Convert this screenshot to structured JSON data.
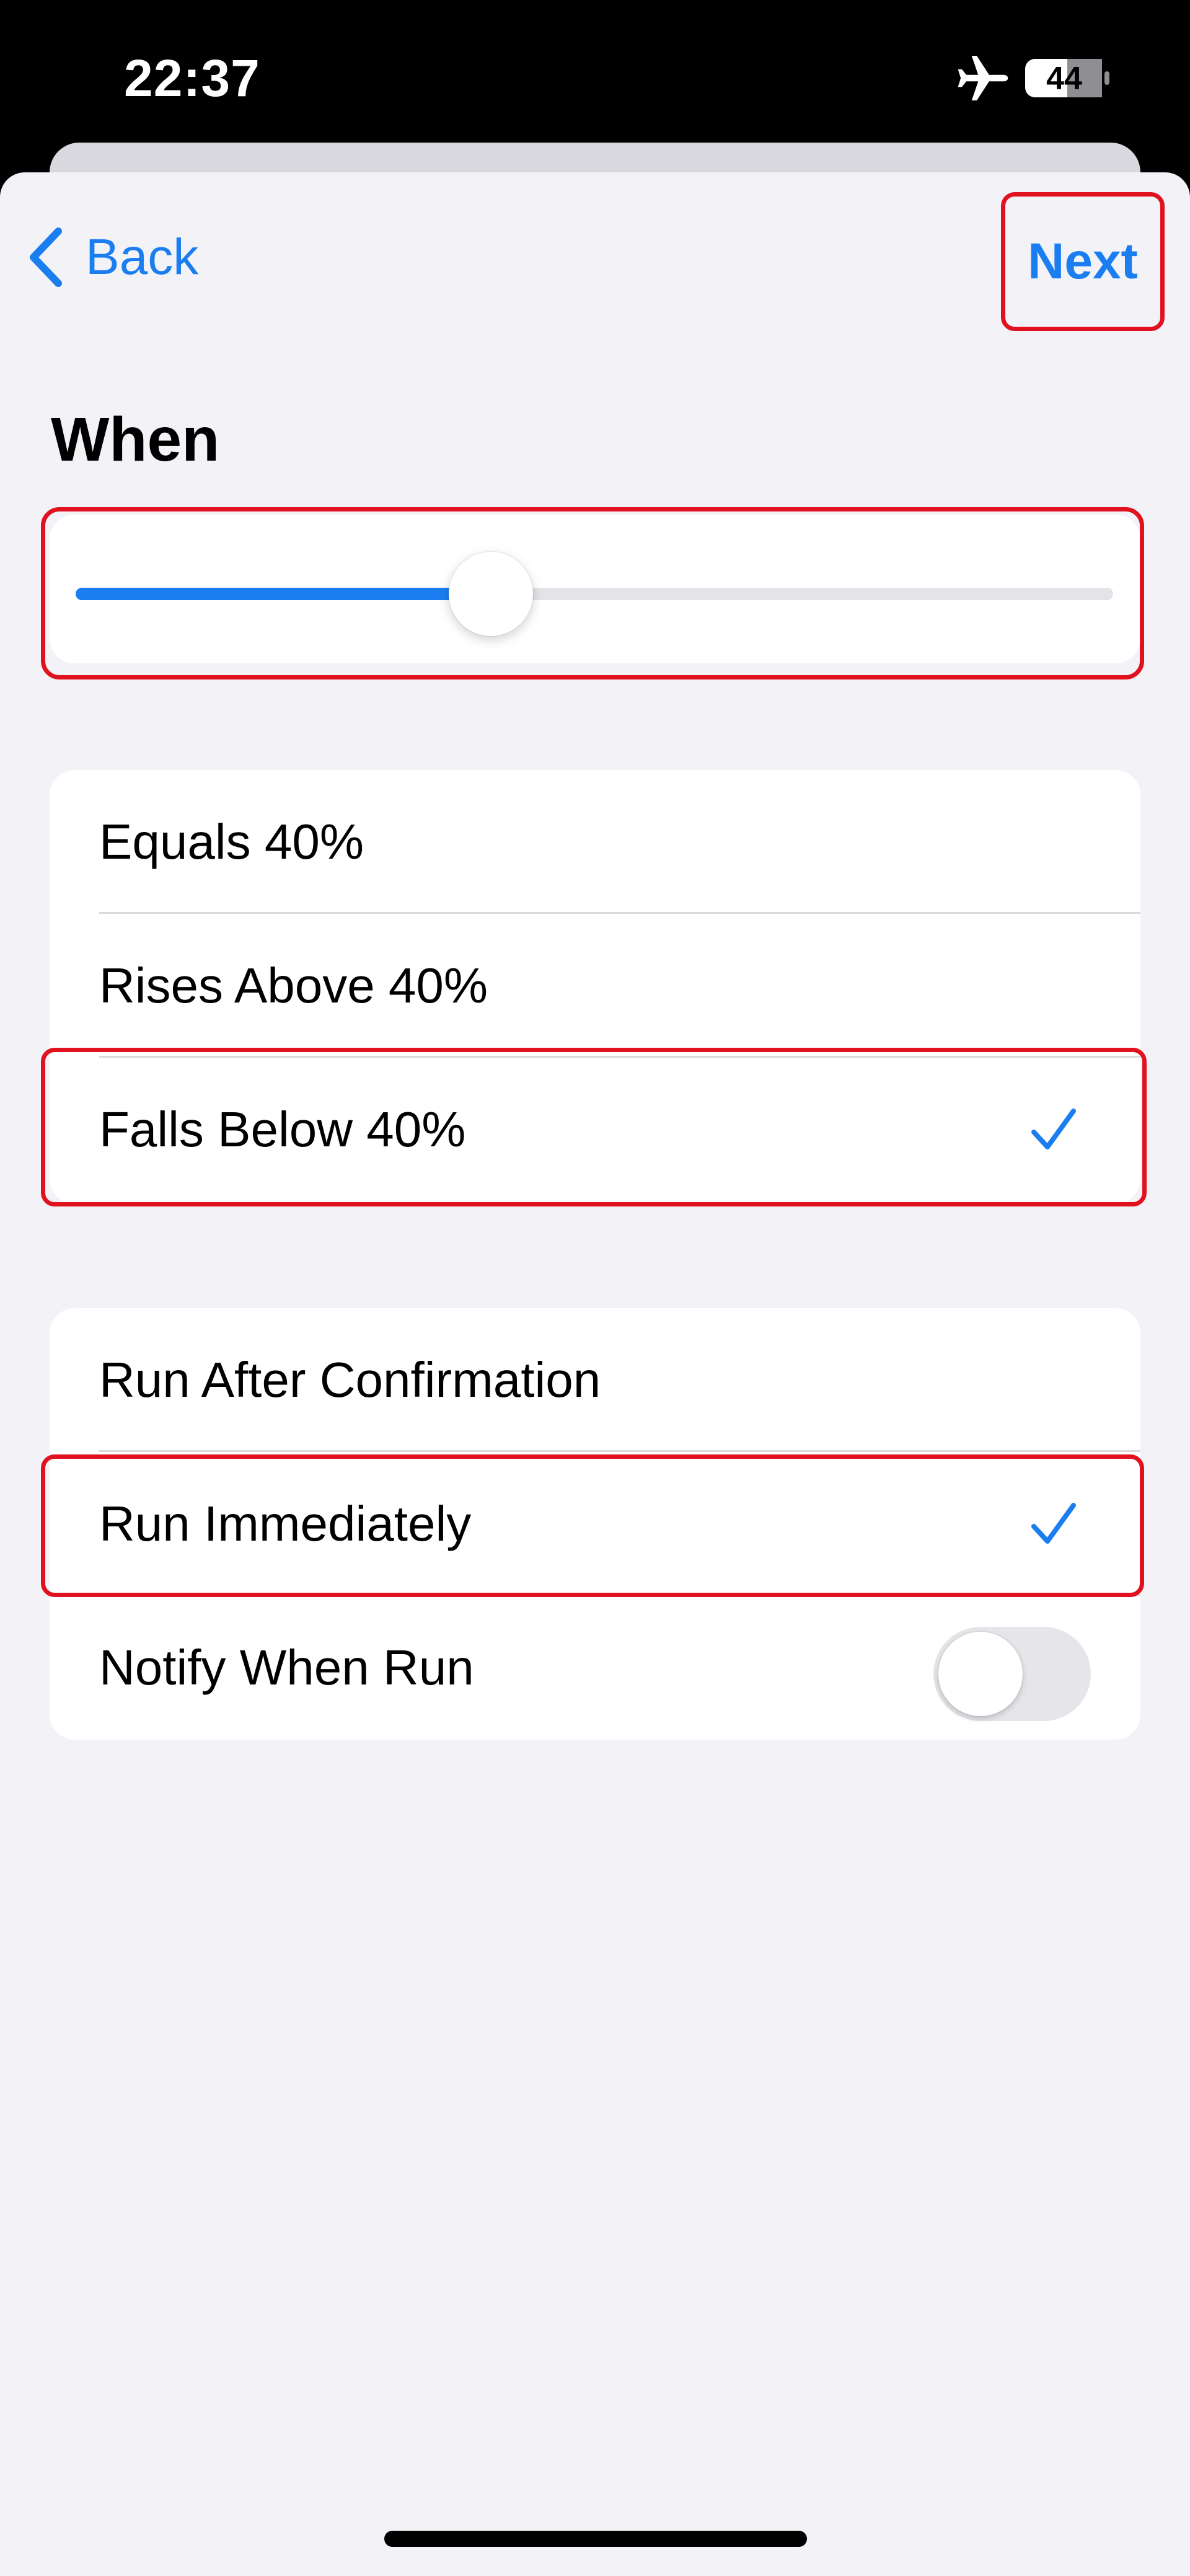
{
  "status_bar": {
    "time": "22:37",
    "battery_level": "44",
    "icons": [
      "airplane-icon",
      "battery-icon"
    ]
  },
  "nav": {
    "back_label": "Back",
    "next_label": "Next"
  },
  "section": {
    "title": "When"
  },
  "slider": {
    "value_fraction": 0.4
  },
  "conditions": {
    "items": [
      {
        "label": "Equals 40%",
        "selected": false
      },
      {
        "label": "Rises Above 40%",
        "selected": false
      },
      {
        "label": "Falls Below 40%",
        "selected": true
      }
    ]
  },
  "run_options": {
    "items": [
      {
        "label": "Run After Confirmation",
        "selected": false
      },
      {
        "label": "Run Immediately",
        "selected": true
      }
    ],
    "notify_label": "Notify When Run",
    "notify_enabled": false
  },
  "colors": {
    "accent": "#1a7ef0",
    "highlight": "#e1121f",
    "background": "#f2f2f7"
  }
}
